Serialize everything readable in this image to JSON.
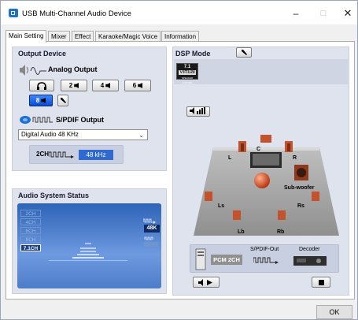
{
  "window": {
    "title": "USB Multi-Channel Audio Device",
    "controls": {
      "minimize": "–",
      "maximize": "□",
      "close": "✕"
    }
  },
  "tabs": [
    {
      "label": "Main Setting",
      "active": true
    },
    {
      "label": "Mixer",
      "active": false
    },
    {
      "label": "Effect",
      "active": false
    },
    {
      "label": "Karaoke/Magic Voice",
      "active": false
    },
    {
      "label": "Information",
      "active": false
    }
  ],
  "output_device": {
    "title": "Output Device",
    "analog_label": "Analog Output",
    "channel_buttons": [
      {
        "label": "",
        "icon": "headphones-icon",
        "selected": false
      },
      {
        "label": "2",
        "icon": "speaker-icon",
        "selected": false
      },
      {
        "label": "4",
        "icon": "speaker-icon",
        "selected": false
      },
      {
        "label": "6",
        "icon": "speaker-icon",
        "selected": false
      },
      {
        "label": "8",
        "icon": "speaker-icon",
        "selected": true
      }
    ],
    "spdif_label": "S/PDIF Output",
    "spdif_select": "Digital Audio 48 KHz",
    "freq_channels": "2CH",
    "freq_value": "48 kHz"
  },
  "audio_status": {
    "title": "Audio System Status",
    "channel_modes": [
      "2CH",
      "4CH",
      "6CH",
      "8CH",
      "7.1CH"
    ],
    "selected_mode": "7.1CH",
    "sample_rate": "48K"
  },
  "dsp": {
    "title": "DSP Mode",
    "virtual_badge": {
      "line1": "7.1",
      "line2": "Virtual",
      "line3": "SPEAKER SHIFTER"
    },
    "speakers": {
      "c": "C",
      "l": "L",
      "r": "R",
      "sub": "Sub-woofer",
      "ls": "Ls",
      "rs": "Rs",
      "lb": "Lb",
      "rb": "Rb"
    },
    "spdif_out_label": "S/PDIF-Out",
    "decoder_label": "Decoder",
    "pcm_label": "PCM 2CH"
  },
  "footer": {
    "ok_label": "OK"
  },
  "colors": {
    "accent": "#2e6ad0",
    "panel": "#dfe3ee",
    "selected_button": "#0b4cd1"
  }
}
